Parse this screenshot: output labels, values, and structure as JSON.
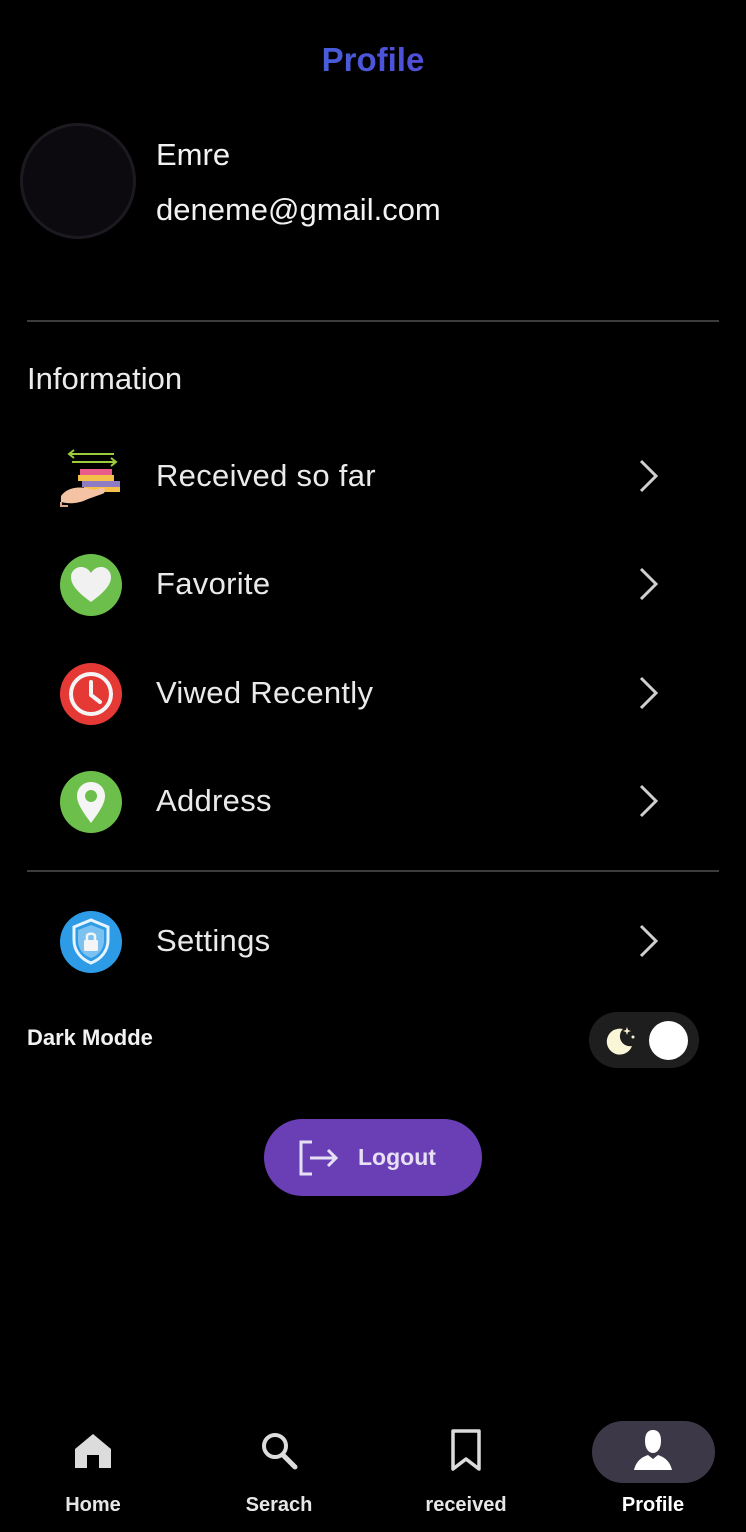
{
  "header": {
    "title": "Profile"
  },
  "user": {
    "name": "Emre",
    "email": "deneme@gmail.com"
  },
  "information": {
    "heading": "Information",
    "items": [
      {
        "label": "Received so far",
        "icon": "books-in-hand-icon"
      },
      {
        "label": "Favorite",
        "icon": "heart-icon",
        "color": "#6cbf4b"
      },
      {
        "label": "Viwed Recently",
        "icon": "clock-icon",
        "color": "#e53935"
      },
      {
        "label": "Address",
        "icon": "location-pin-icon",
        "color": "#6cbf4b"
      }
    ]
  },
  "settings": {
    "label": "Settings",
    "icon": "shield-lock-icon",
    "color": "#2e9be6"
  },
  "dark_mode": {
    "label": "Dark Modde",
    "enabled": true,
    "icon": "moon-stars-icon"
  },
  "logout": {
    "label": "Logout",
    "icon": "logout-icon",
    "color": "#6a3fb6"
  },
  "bottom_nav": {
    "items": [
      {
        "label": "Home",
        "icon": "home-icon"
      },
      {
        "label": "Serach",
        "icon": "search-icon"
      },
      {
        "label": "received",
        "icon": "bookmark-icon"
      },
      {
        "label": "Profile",
        "icon": "person-icon",
        "active": true
      }
    ]
  },
  "colors": {
    "background": "#000000",
    "title_gradient": [
      "#2f8bdc",
      "#6a1fd6"
    ],
    "nav_active": "#3d3848"
  }
}
